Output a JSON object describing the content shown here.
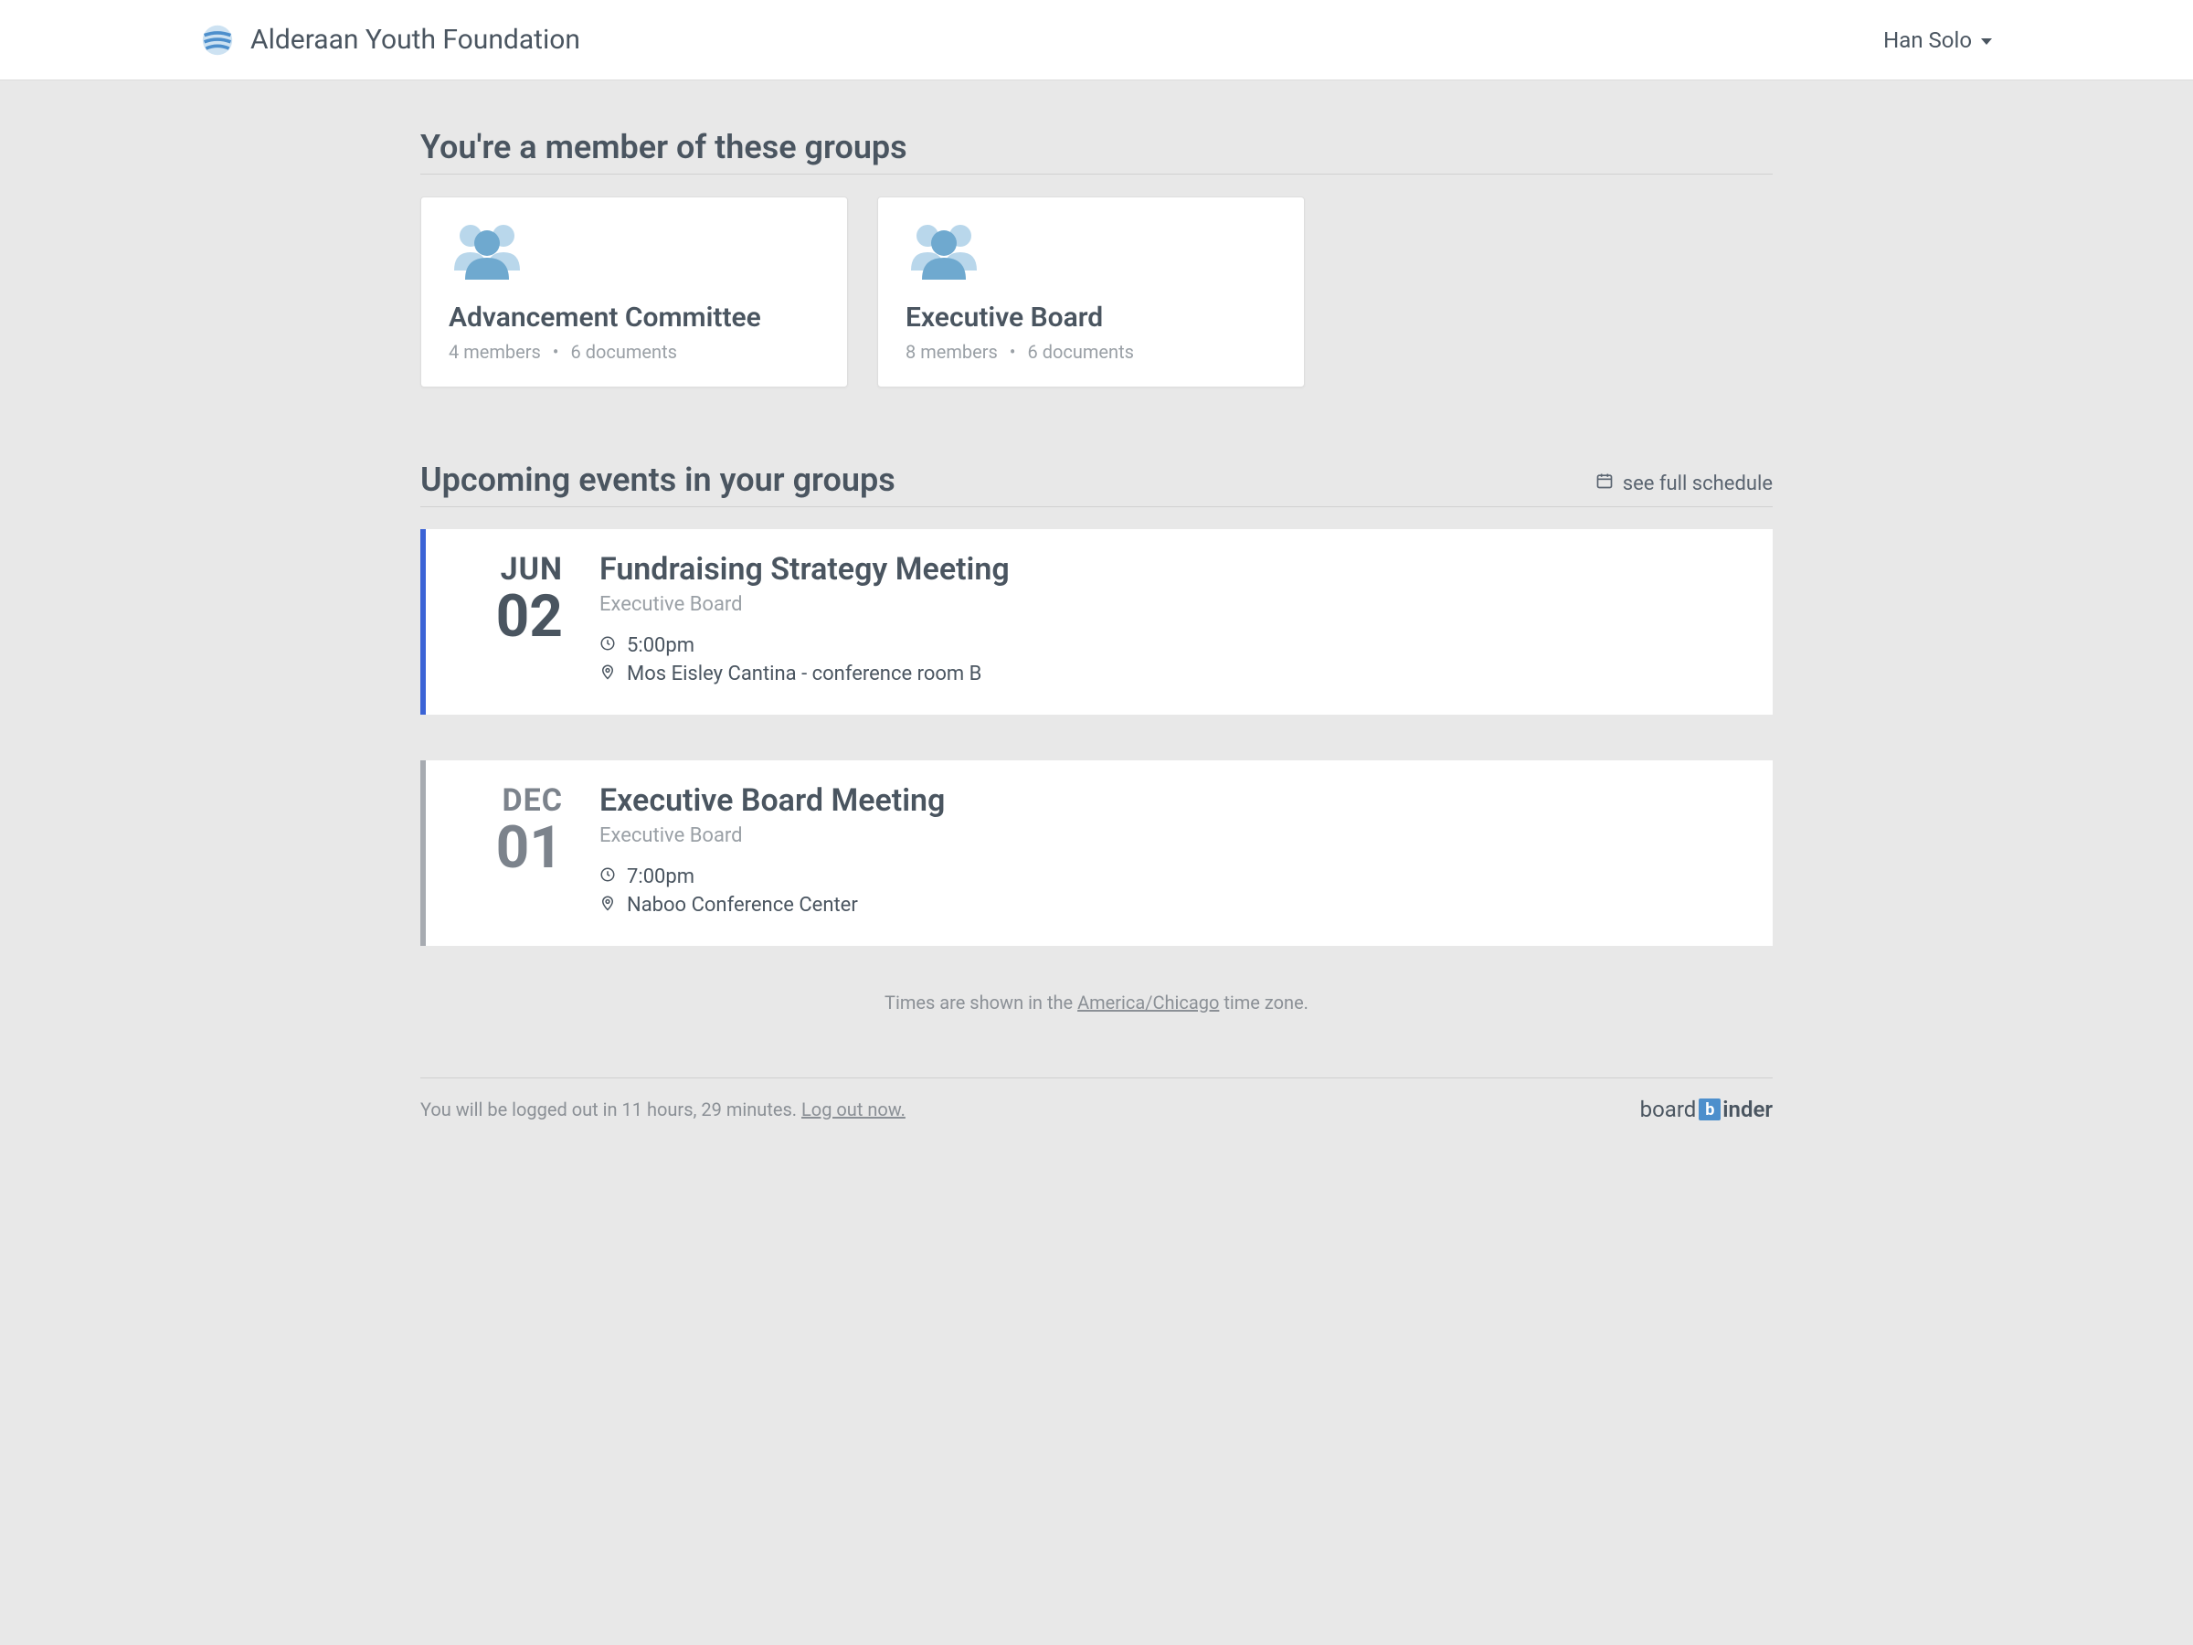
{
  "header": {
    "org_name": "Alderaan Youth Foundation",
    "user_name": "Han Solo"
  },
  "groups_section": {
    "title": "You're a member of these groups",
    "groups": [
      {
        "name": "Advancement Committee",
        "members": "4 members",
        "documents": "6 documents"
      },
      {
        "name": "Executive Board",
        "members": "8 members",
        "documents": "6 documents"
      }
    ]
  },
  "events_section": {
    "title": "Upcoming events in your groups",
    "see_full_label": "see full schedule",
    "events": [
      {
        "month": "JUN",
        "day": "02",
        "title": "Fundraising Strategy Meeting",
        "group": "Executive Board",
        "time": "5:00pm",
        "location": "Mos Eisley Cantina - conference room B",
        "accent": true
      },
      {
        "month": "DEC",
        "day": "01",
        "title": "Executive Board Meeting",
        "group": "Executive Board",
        "time": "7:00pm",
        "location": "Naboo Conference Center",
        "accent": false
      }
    ],
    "tz_prefix": "Times are shown in the ",
    "tz_name": "America/Chicago",
    "tz_suffix": " time zone."
  },
  "footer": {
    "logout_message": "You will be logged out in 11 hours, 29 minutes. ",
    "logout_link": "Log out now.",
    "brand_part1": "board",
    "brand_tile": "b",
    "brand_part2": "inder"
  }
}
